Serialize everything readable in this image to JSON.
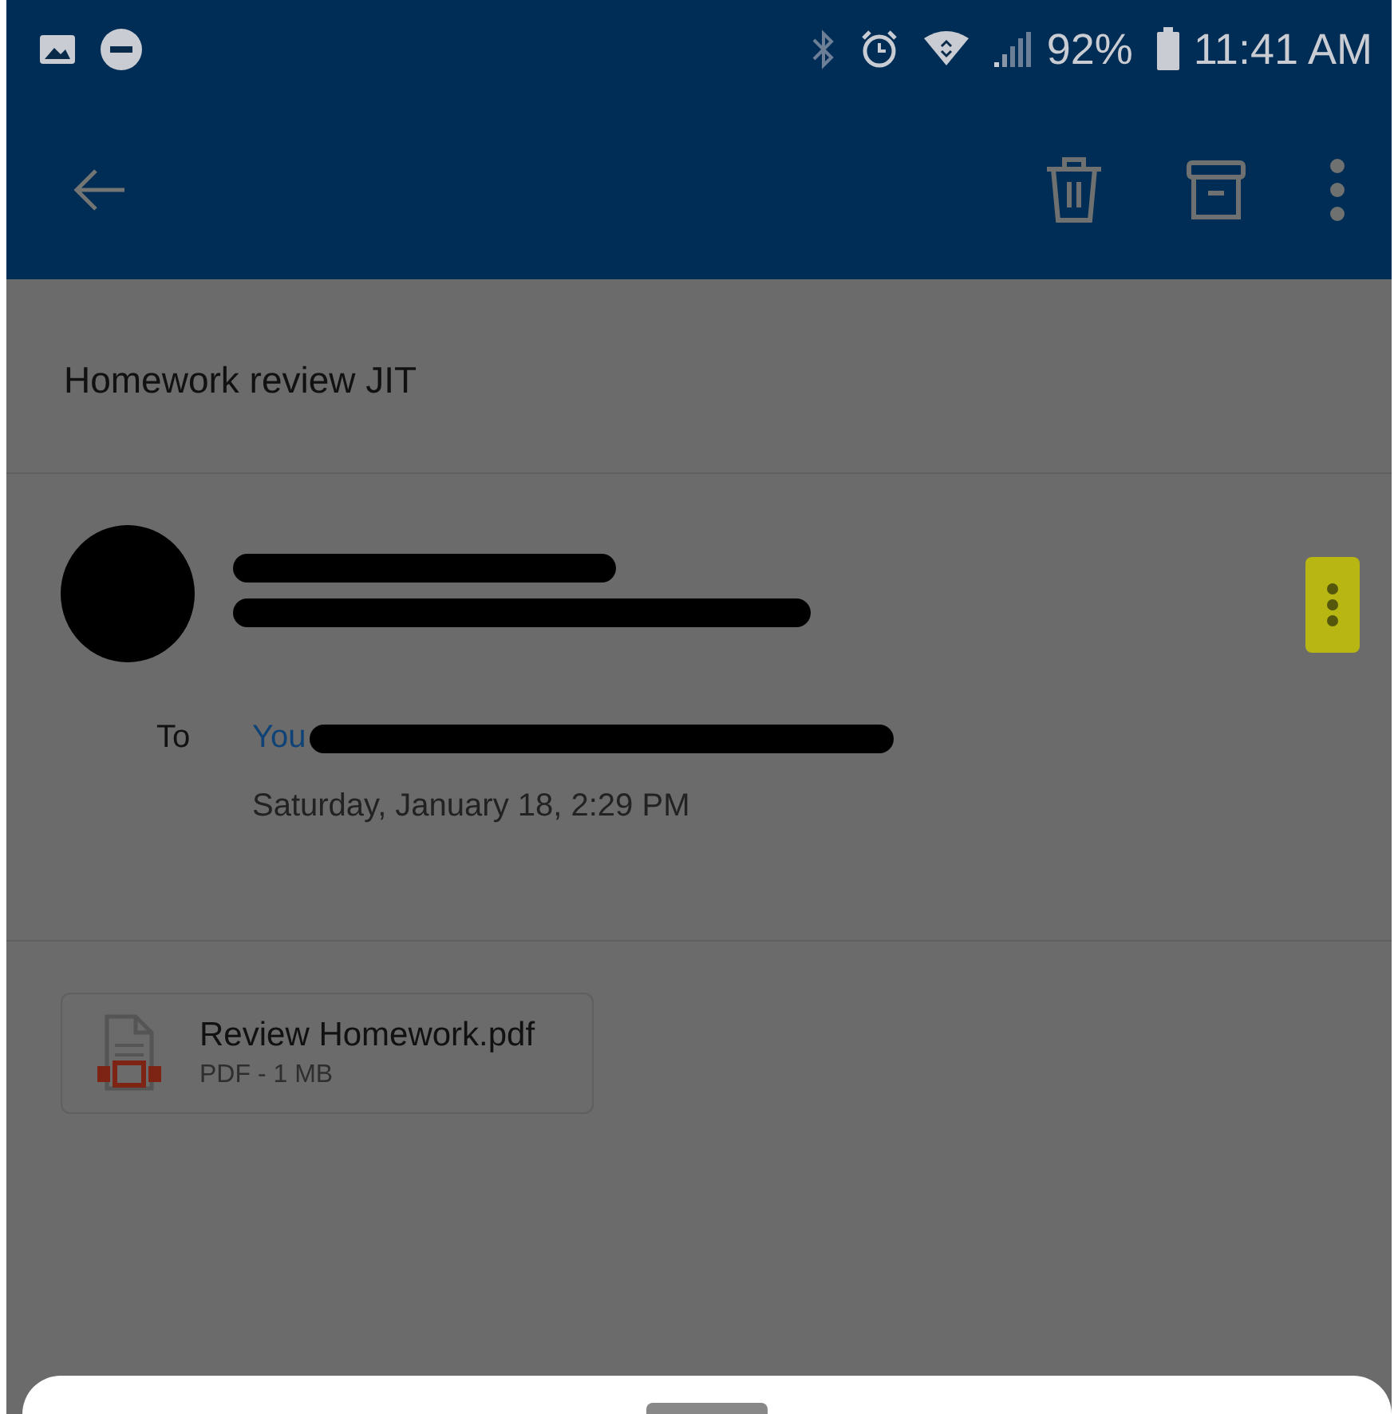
{
  "status_bar": {
    "battery": "92%",
    "time": "11:41 AM"
  },
  "subject": "Homework review JIT",
  "message": {
    "recipient_label": "To",
    "recipient": "You",
    "date": "Saturday, January 18, 2:29 PM"
  },
  "attachment": {
    "name": "Review Homework.pdf",
    "meta": "PDF - 1 MB"
  }
}
